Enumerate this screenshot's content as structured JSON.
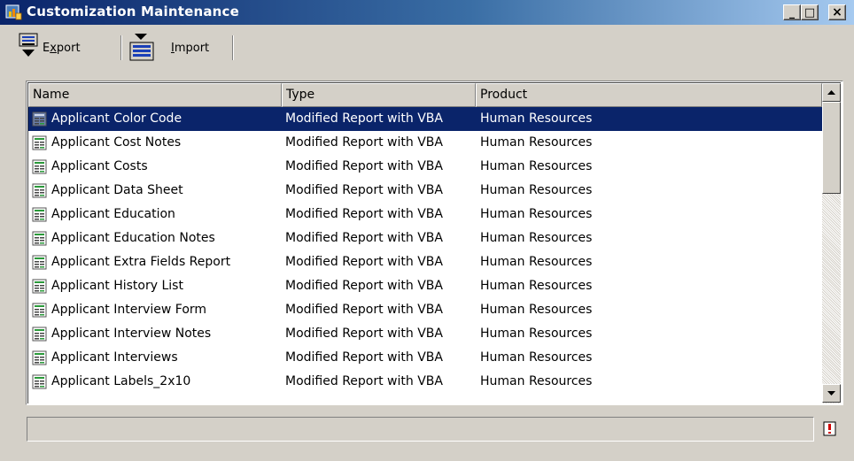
{
  "window": {
    "title": "Customization Maintenance",
    "minimize_label": "_",
    "maximize_label": "□",
    "close_label": "×",
    "title_bar_color": "#0a246a"
  },
  "toolbar": {
    "export_label": "Export",
    "export_access_key": "x",
    "import_label": "Import",
    "import_access_key": "I",
    "export_icon": "export-icon",
    "import_icon": "import-icon"
  },
  "table": {
    "columns": [
      "Name",
      "Type",
      "Product"
    ],
    "selected_row": 0,
    "selection_color": "#0a246a",
    "row_icon": "report-document-icon",
    "rows": [
      {
        "name": "Applicant Color Code",
        "type": "Modified Report with VBA",
        "product": "Human Resources"
      },
      {
        "name": "Applicant Cost Notes",
        "type": "Modified Report with VBA",
        "product": "Human Resources"
      },
      {
        "name": "Applicant Costs",
        "type": "Modified Report with VBA",
        "product": "Human Resources"
      },
      {
        "name": "Applicant Data Sheet",
        "type": "Modified Report with VBA",
        "product": "Human Resources"
      },
      {
        "name": "Applicant Education",
        "type": "Modified Report with VBA",
        "product": "Human Resources"
      },
      {
        "name": "Applicant Education Notes",
        "type": "Modified Report with VBA",
        "product": "Human Resources"
      },
      {
        "name": "Applicant Extra Fields Report",
        "type": "Modified Report with VBA",
        "product": "Human Resources"
      },
      {
        "name": "Applicant History List",
        "type": "Modified Report with VBA",
        "product": "Human Resources"
      },
      {
        "name": "Applicant Interview Form",
        "type": "Modified Report with VBA",
        "product": "Human Resources"
      },
      {
        "name": "Applicant Interview Notes",
        "type": "Modified Report with VBA",
        "product": "Human Resources"
      },
      {
        "name": "Applicant Interviews",
        "type": "Modified Report with VBA",
        "product": "Human Resources"
      },
      {
        "name": "Applicant Labels_2x10",
        "type": "Modified Report with VBA",
        "product": "Human Resources"
      }
    ]
  },
  "statusbar": {
    "text": "",
    "status_icon": "alert-document-icon"
  }
}
